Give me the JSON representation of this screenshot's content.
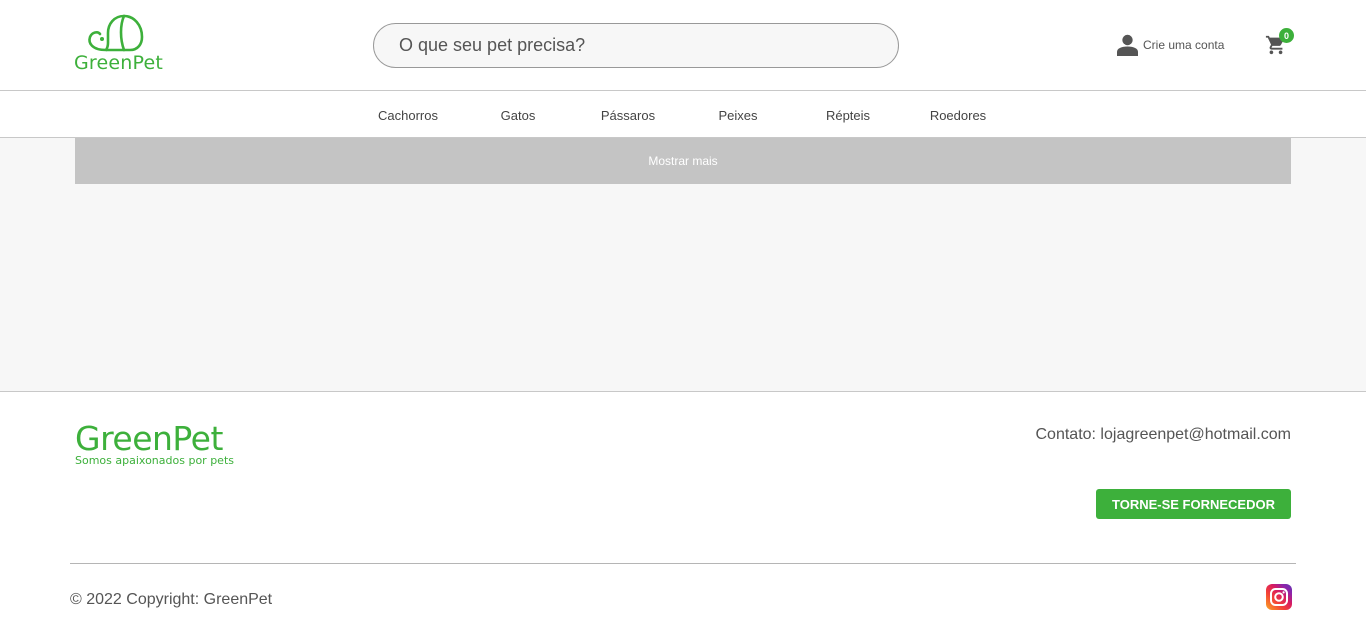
{
  "header": {
    "logo_text": "GreenPet",
    "search_placeholder": "O que seu pet precisa?",
    "account_label": "Crie uma conta",
    "cart_count": "0"
  },
  "categories": [
    "Cachorros",
    "Gatos",
    "Pássaros",
    "Peixes",
    "Répteis",
    "Roedores"
  ],
  "main": {
    "show_more_label": "Mostrar mais"
  },
  "footer": {
    "brand_name": "GreenPet",
    "brand_tagline": "Somos apaixonados por pets",
    "contact": "Contato: lojagreenpet@hotmail.com",
    "supplier_button": "TORNE-SE FORNECEDOR",
    "copyright": "© 2022 Copyright: GreenPet"
  },
  "colors": {
    "brand_green": "#3db03b",
    "show_more_bg": "#c4c4c4",
    "main_bg": "#f7f7f7"
  },
  "icons": {
    "logo": "dog-face-icon",
    "account": "user-icon",
    "cart": "cart-icon",
    "social": "instagram-icon"
  }
}
